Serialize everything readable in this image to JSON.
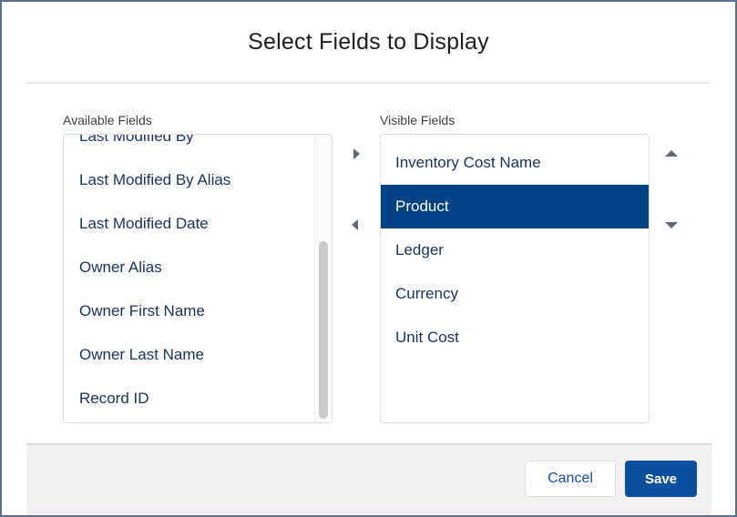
{
  "dialog": {
    "title": "Select Fields to Display"
  },
  "available": {
    "label": "Available Fields",
    "items": [
      "Last Modified By",
      "Last Modified By Alias",
      "Last Modified Date",
      "Owner Alias",
      "Owner First Name",
      "Owner Last Name",
      "Record ID"
    ]
  },
  "visible": {
    "label": "Visible Fields",
    "items": [
      "Inventory Cost Name",
      "Product",
      "Ledger",
      "Currency",
      "Unit Cost"
    ],
    "selected": "Product"
  },
  "controls": {
    "move_right_icon": "caret-right-icon",
    "move_left_icon": "caret-left-icon",
    "move_up_icon": "caret-up-icon",
    "move_down_icon": "caret-down-icon"
  },
  "footer": {
    "cancel_label": "Cancel",
    "save_label": "Save"
  },
  "colors": {
    "selected_row": "#034284",
    "save_button": "#0b4f9e",
    "frame_border": "#5a6f8c"
  }
}
